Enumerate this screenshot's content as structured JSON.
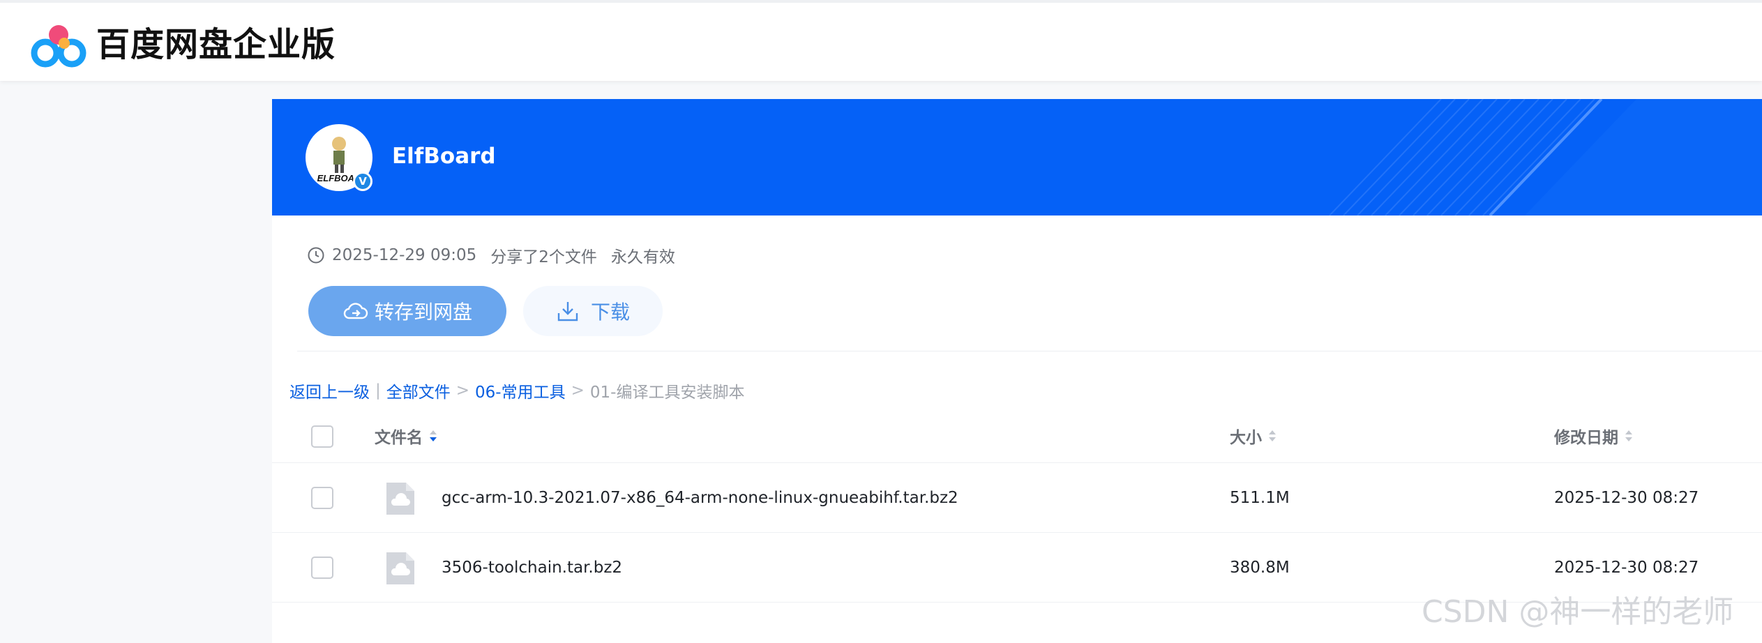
{
  "header": {
    "brand_name": "百度网盘企业版",
    "logo_icon": "baidu-netdisk-cloud-logo",
    "brand_colors": {
      "blue": "#1aa0f7",
      "pink": "#f04b7a",
      "orange": "#fbb040"
    }
  },
  "share": {
    "banner_color": "#0561f7",
    "owner_name": "ElfBoard",
    "verified_badge": "V",
    "time": "2025-12-29 09:05",
    "shared_text": "分享了2个文件",
    "validity": "永久有效"
  },
  "actions": {
    "save_label": "转存到网盘",
    "download_label": "下载",
    "save_color": "#6aa6ee"
  },
  "breadcrumb": {
    "back": "返回上一级",
    "divider": "|",
    "all_files": "全部文件",
    "sep1": ">",
    "folder": "06-常用工具",
    "sep2": ">",
    "current": "01-编译工具安装脚本"
  },
  "table": {
    "columns": {
      "name": "文件名",
      "size": "大小",
      "date": "修改日期"
    },
    "rows": [
      {
        "name": "gcc-arm-10.3-2021.07-x86_64-arm-none-linux-gnueabihf.tar.bz2",
        "size": "511.1M",
        "date": "2025-12-30 08:27",
        "icon": "cloud-file-icon"
      },
      {
        "name": "3506-toolchain.tar.bz2",
        "size": "380.8M",
        "date": "2025-12-30 08:27",
        "icon": "cloud-file-icon"
      }
    ]
  },
  "watermark": "CSDN @神一样的老师"
}
